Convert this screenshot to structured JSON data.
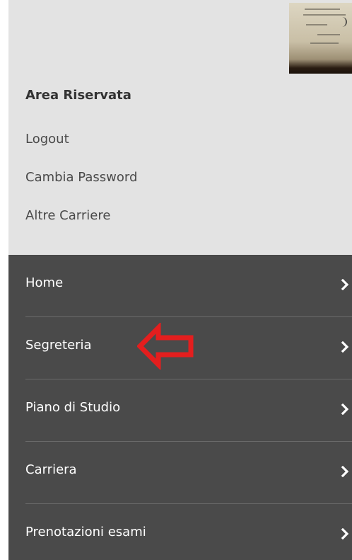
{
  "account": {
    "section_title": "Area Riservata",
    "links": [
      {
        "label": "Logout"
      },
      {
        "label": "Cambia Password"
      },
      {
        "label": "Altre Carriere"
      }
    ]
  },
  "menu": {
    "items": [
      {
        "label": "Home",
        "icon": "chevron-right-icon"
      },
      {
        "label": "Segreteria",
        "icon": "chevron-right-icon"
      },
      {
        "label": "Piano di Studio",
        "icon": "chevron-right-icon"
      },
      {
        "label": "Carriera",
        "icon": "chevron-right-icon"
      },
      {
        "label": "Prenotazioni esami",
        "icon": "chevron-right-icon"
      }
    ]
  },
  "annotation": {
    "arrow_color": "#e41e1e",
    "points_to": "Segreteria"
  },
  "colors": {
    "top_background": "#e3e3e3",
    "menu_background": "#4a4a4a",
    "menu_text": "#ffffff"
  }
}
